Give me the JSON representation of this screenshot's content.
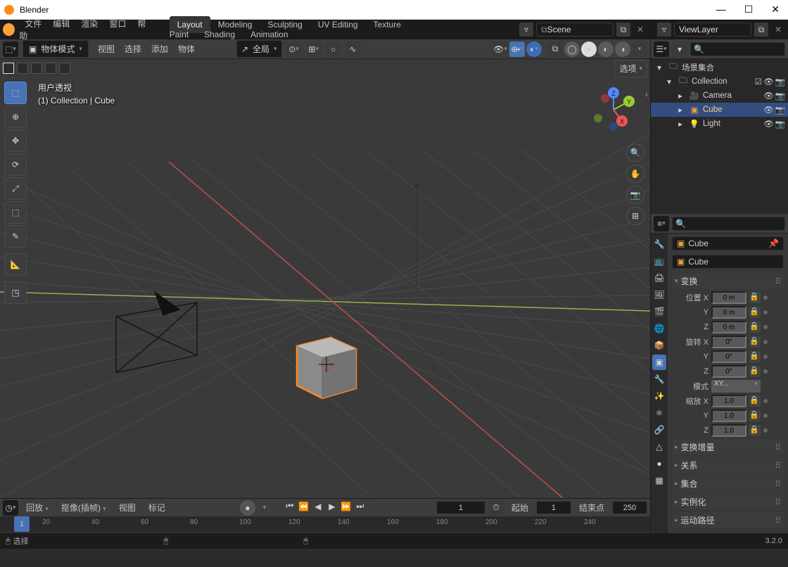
{
  "title": "Blender",
  "topmenu": [
    "文件",
    "编辑",
    "渲染",
    "窗口",
    "帮助"
  ],
  "workspaces": [
    "Layout",
    "Modeling",
    "Sculpting",
    "UV Editing",
    "Texture Paint",
    "Shading",
    "Animation"
  ],
  "active_workspace": 0,
  "scene_label": "Scene",
  "viewlayer_label": "ViewLayer",
  "viewport": {
    "mode": "物体模式",
    "menu": [
      "视图",
      "选择",
      "添加",
      "物体"
    ],
    "orientation": "全局",
    "options_label": "选项",
    "info1": "用户透视",
    "info2": "(1) Collection | Cube"
  },
  "outliner": {
    "scene_collection": "场景集合",
    "collection": "Collection",
    "items": [
      "Camera",
      "Cube",
      "Light"
    ],
    "selected": 1
  },
  "properties": {
    "crumb1": "Cube",
    "crumb2": "Cube",
    "transform_label": "变换",
    "loc_label": "位置",
    "rot_label": "旋转",
    "scale_label": "缩放",
    "mode_label": "模式",
    "mode_value": "XY...",
    "axes": [
      "X",
      "Y",
      "Z"
    ],
    "loc_vals": [
      "0 m",
      "0 m",
      "0 m"
    ],
    "rot_vals": [
      "0°",
      "0°",
      "0°"
    ],
    "scale_vals": [
      "1.0",
      "1.0",
      "1.0"
    ],
    "panels": [
      "变换增量",
      "关系",
      "集合",
      "实例化",
      "运动路径"
    ]
  },
  "timeline": {
    "play_label": "回放",
    "key_label": "抠像(插帧)",
    "view": "视图",
    "marker": "标记",
    "frame": "1",
    "start_label": "起始",
    "start": "1",
    "end_label": "结束点",
    "end": "250",
    "ticks": [
      "20",
      "40",
      "60",
      "80",
      "100",
      "120",
      "140",
      "160",
      "180",
      "200",
      "220",
      "240"
    ]
  },
  "status": {
    "select": "选择"
  },
  "version": "3.2.0"
}
